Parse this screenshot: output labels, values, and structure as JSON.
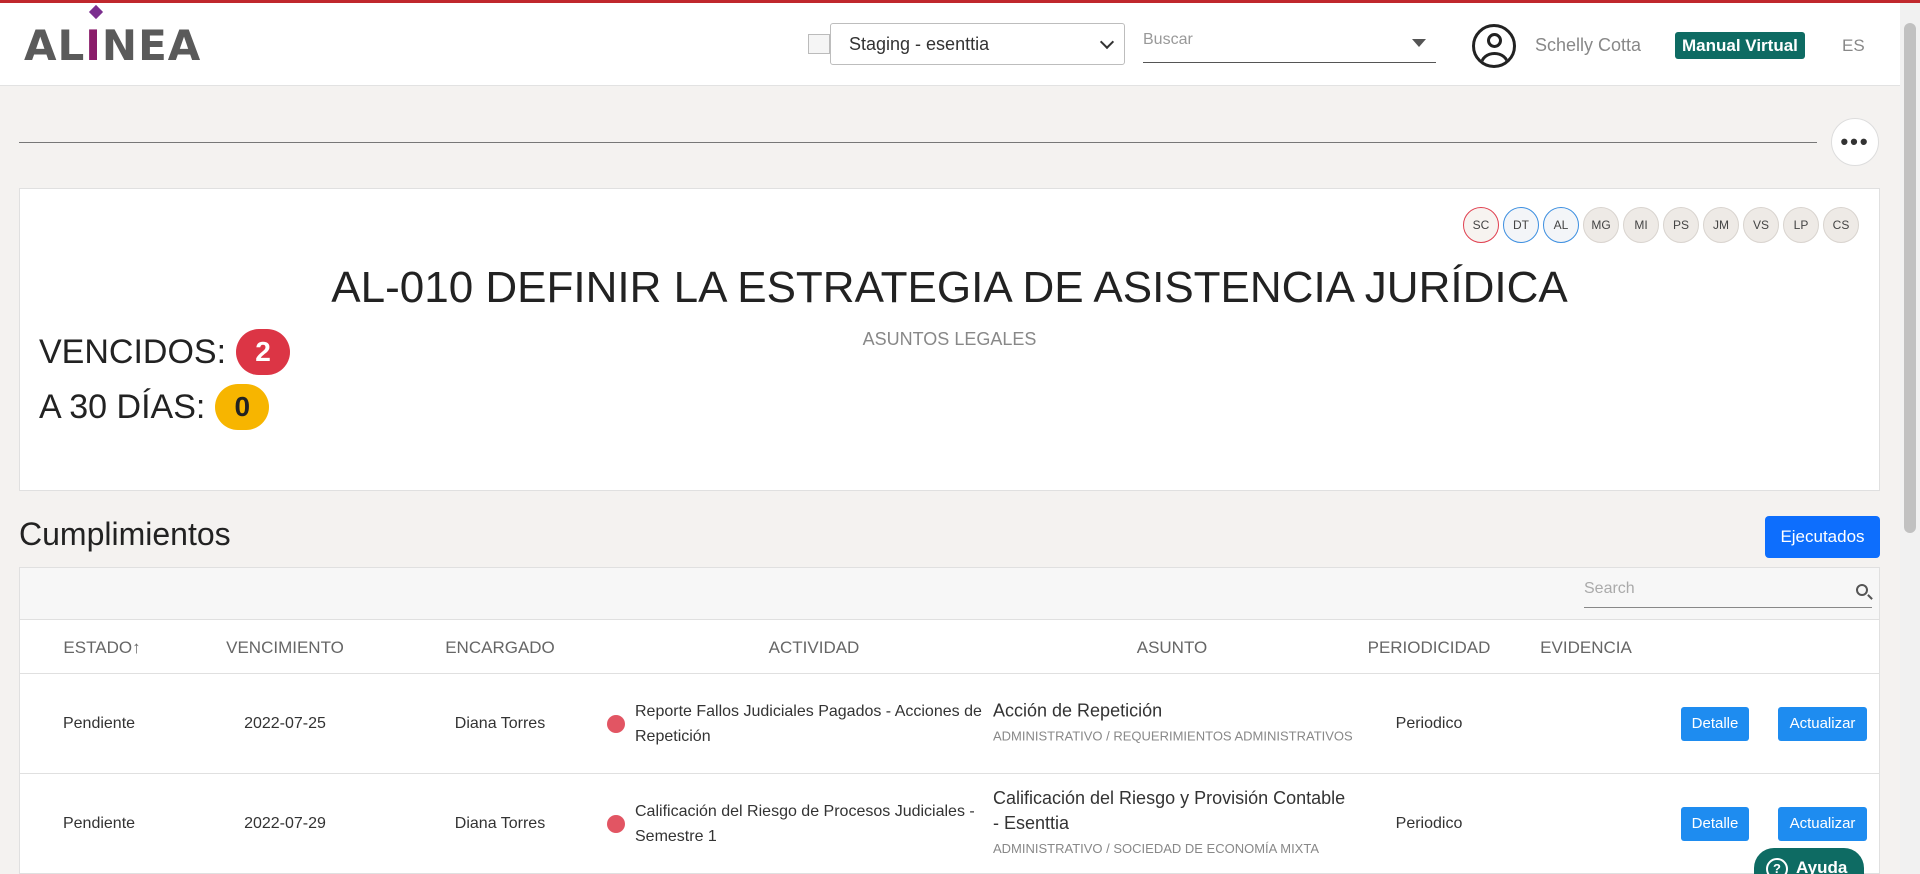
{
  "header": {
    "logo_text_pre": "AL",
    "logo_text_i": "I",
    "logo_text_post": "NEA",
    "environment": "Staging - esenttia",
    "search_placeholder": "Buscar",
    "user_name": "Schelly Cotta",
    "manual_label": "Manual Virtual",
    "language": "ES"
  },
  "card": {
    "avatars": [
      {
        "initials": "SC",
        "style": "red"
      },
      {
        "initials": "DT",
        "style": "blue"
      },
      {
        "initials": "AL",
        "style": "blue"
      },
      {
        "initials": "MG",
        "style": "plain"
      },
      {
        "initials": "MI",
        "style": "plain"
      },
      {
        "initials": "PS",
        "style": "plain"
      },
      {
        "initials": "JM",
        "style": "plain"
      },
      {
        "initials": "VS",
        "style": "plain"
      },
      {
        "initials": "LP",
        "style": "plain"
      },
      {
        "initials": "CS",
        "style": "plain"
      }
    ],
    "title": "AL-010 DEFINIR LA ESTRATEGIA DE ASISTENCIA JURÍDICA",
    "subtitle": "ASUNTOS LEGALES",
    "vencidos_label": "VENCIDOS:",
    "vencidos_count": "2",
    "treinta_label": "A 30 DÍAS:",
    "treinta_count": "0"
  },
  "cumplimientos": {
    "title": "Cumplimientos",
    "ejecutados_label": "Ejecutados",
    "search_placeholder": "Search",
    "columns": [
      "ESTADO↑",
      "VENCIMIENTO",
      "ENCARGADO",
      "ACTIVIDAD",
      "ASUNTO",
      "PERIODICIDAD",
      "EVIDENCIA"
    ],
    "rows": [
      {
        "estado": "Pendiente",
        "vencimiento": "2022-07-25",
        "encargado": "Diana Torres",
        "actividad": "Reporte Fallos Judiciales Pagados - Acciones de Repetición",
        "asunto": "Acción de Repetición",
        "asunto_sub": "ADMINISTRATIVO / REQUERIMIENTOS ADMINISTRATIVOS",
        "periodicidad": "Periodico",
        "evidencia": "",
        "detalle_label": "Detalle",
        "actualizar_label": "Actualizar"
      },
      {
        "estado": "Pendiente",
        "vencimiento": "2022-07-29",
        "encargado": "Diana Torres",
        "actividad": "Calificación del Riesgo de Procesos Judiciales - Semestre 1",
        "asunto": "Calificación del Riesgo y Provisión Contable - Esenttia",
        "asunto_sub": "ADMINISTRATIVO / SOCIEDAD DE ECONOMÍA MIXTA",
        "periodicidad": "Periodico",
        "evidencia": "",
        "detalle_label": "Detalle",
        "actualizar_label": "Actualizar"
      }
    ]
  },
  "help_label": "Ayuda",
  "colors": {
    "brand_teal": "#0e6b63",
    "primary_blue": "#0d6efd",
    "danger": "#dc3545",
    "warning": "#f7b500",
    "logo_purple": "#8a1d6a"
  }
}
